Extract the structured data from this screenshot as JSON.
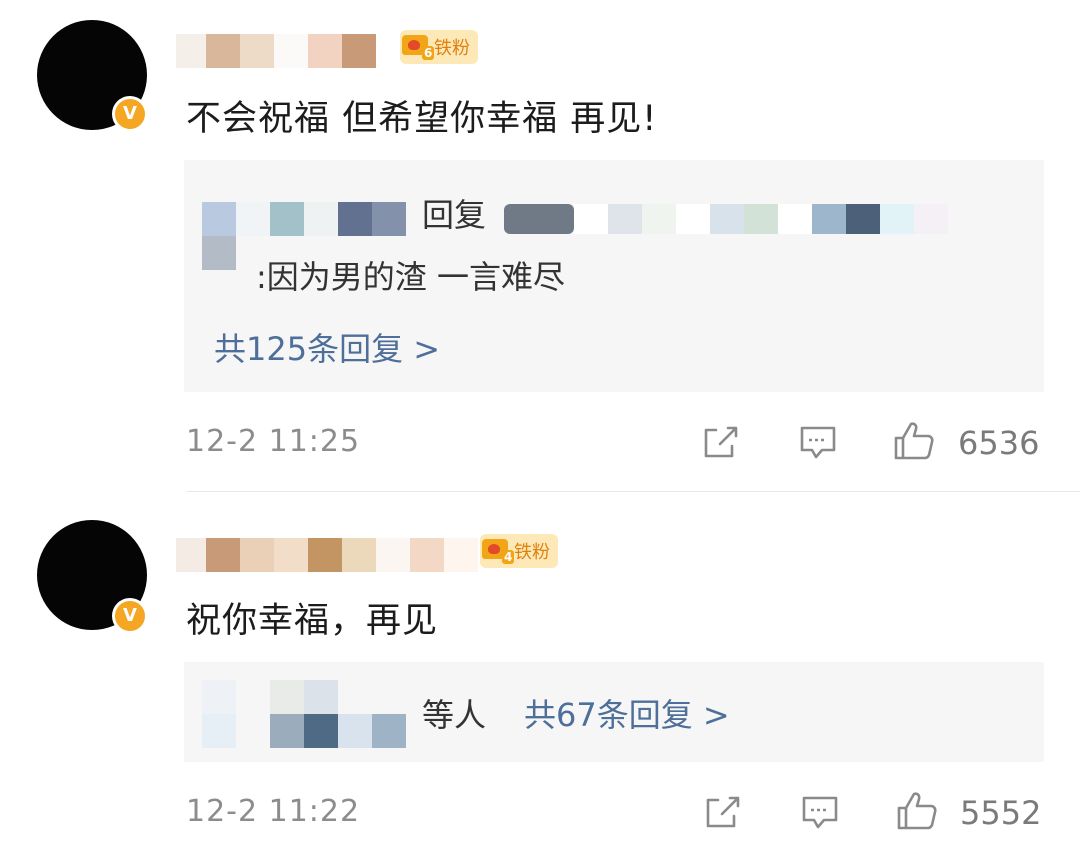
{
  "comments": [
    {
      "text": "不会祝福 但希望你幸福 再见!",
      "verified_badge": "V",
      "fan_badge": {
        "level": "6",
        "label": "铁粉"
      },
      "reply": {
        "reply_word": "回复",
        "content": ":因为男的渣 一言难尽",
        "more_link": "共125条回复 >"
      },
      "time": "12-2 11:25",
      "likes": "6536",
      "icons": [
        "share-icon",
        "comment-icon",
        "like-icon"
      ]
    },
    {
      "text": "祝你幸福，再见",
      "verified_badge": "V",
      "fan_badge": {
        "level": "4",
        "label": "铁粉"
      },
      "reply": {
        "others_word": "等人",
        "more_link": "共67条回复 >"
      },
      "time": "12-2 11:22",
      "likes": "5552",
      "icons": [
        "share-icon",
        "comment-icon",
        "like-icon"
      ]
    }
  ],
  "colors": {
    "link": "#4e6f99",
    "badge_orange": "#f5a623",
    "reply_bg": "#f6f6f6",
    "meta_gray": "#8c8c8c"
  }
}
